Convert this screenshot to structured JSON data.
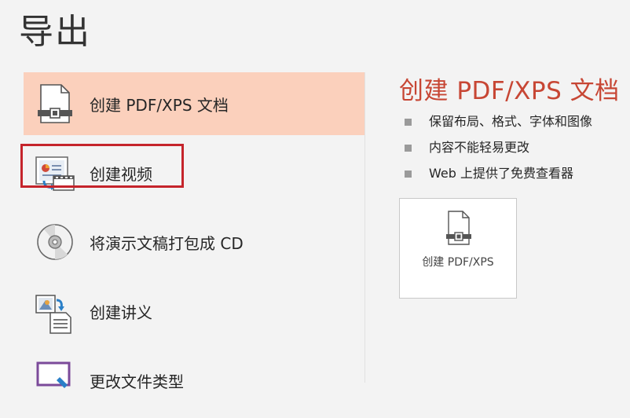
{
  "page": {
    "title": "导出"
  },
  "left_menu": {
    "items": [
      {
        "label": "创建 PDF/XPS 文档",
        "icon": "pdf-document-icon",
        "selected": true
      },
      {
        "label": "创建视频",
        "icon": "video-icon",
        "selected": false
      },
      {
        "label": "将演示文稿打包成 CD",
        "icon": "cd-disc-icon",
        "selected": false
      },
      {
        "label": "创建讲义",
        "icon": "handout-icon",
        "selected": false
      },
      {
        "label": "更改文件类型",
        "icon": "file-type-icon",
        "selected": false
      }
    ]
  },
  "detail": {
    "heading": "创建 PDF/XPS 文档",
    "bullets": [
      "保留布局、格式、字体和图像",
      "内容不能轻易更改",
      "Web 上提供了免费查看器"
    ],
    "button_label": "创建 PDF/XPS",
    "button_icon": "pdf-document-icon"
  },
  "colors": {
    "accent": "#c74634",
    "selected_bg": "#fbd0bc",
    "highlight": "#c5242b"
  }
}
